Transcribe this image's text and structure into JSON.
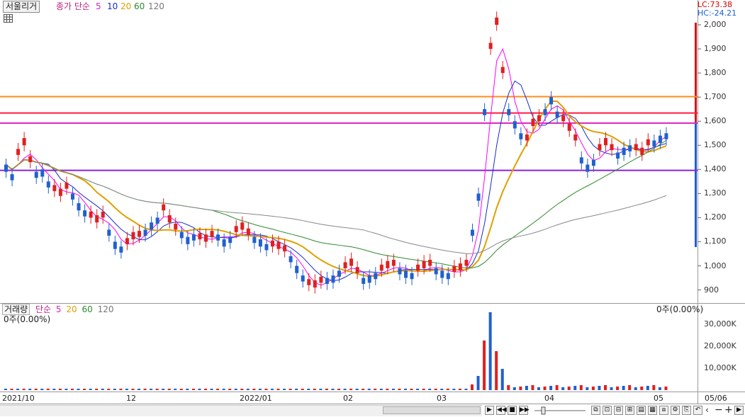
{
  "header": {
    "title": "서울리거",
    "indicator_label": "종가 단순",
    "ma_periods": [
      "5",
      "10",
      "20",
      "60",
      "120"
    ],
    "ma_colors": [
      "#ff00ff",
      "#1a2ecc",
      "#e0a000",
      "#2e8b2e",
      "#888888"
    ],
    "lc_text": "LC:73.38",
    "hc_text": "HC:-24.21",
    "lc_color": "#d40000",
    "hc_color": "#1a5ed8"
  },
  "price_axis": {
    "ticks": [
      "2,000",
      "1,900",
      "1,800",
      "1,700",
      "1,600",
      "1,500",
      "1,400",
      "1,300",
      "1,200",
      "1,100",
      "1,000",
      "900"
    ]
  },
  "volume_panel": {
    "title": "거래량",
    "indicator_label": "단순",
    "ma_periods": [
      "5",
      "20",
      "60",
      "120"
    ],
    "left_value": "0주(0.00%)",
    "right_value": "0주(0.00%)",
    "ticks": [
      "30,000K",
      "20,000K",
      "10,000K"
    ]
  },
  "date_axis": {
    "labels": [
      "2021/10",
      "12",
      "2022/01",
      "02",
      "03",
      "04",
      "05",
      "05/06"
    ]
  },
  "horizontal_lines": [
    {
      "name": "orange-line",
      "price": 1702,
      "color": "#ff8c1a"
    },
    {
      "name": "red-line",
      "price": 1634,
      "color": "#ff1a3c"
    },
    {
      "name": "magenta-line",
      "price": 1592,
      "color": "#e020c0"
    },
    {
      "name": "purple-line",
      "price": 1396,
      "color": "#8a22d8"
    }
  ],
  "colors": {
    "up": "#e02020",
    "down": "#2060d0",
    "background": "#ffffff",
    "grid": "#d8d8d8"
  },
  "toolbar": {
    "zoom_minus_label": "−",
    "zoom_plus_label": "+"
  }
}
